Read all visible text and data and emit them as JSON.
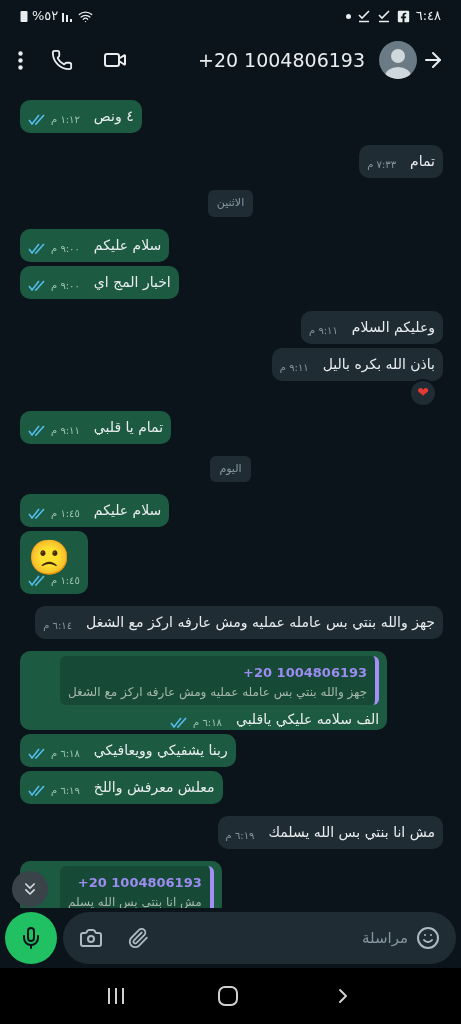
{
  "status_bar": {
    "time": "٦:٤٨",
    "battery": "%٥٢"
  },
  "header": {
    "title": "+20 1004806193"
  },
  "messages": [
    {
      "kind": "sent",
      "text": "٤ ونص",
      "time": "١:١٢ م",
      "read": true
    },
    {
      "kind": "received",
      "text": "تمام",
      "time": "٧:٣٣ م"
    },
    {
      "kind": "date",
      "text": "الاثنين"
    },
    {
      "kind": "sent",
      "text": "سلام عليكم",
      "time": "٩:٠٠ م",
      "read": true
    },
    {
      "kind": "sent",
      "text": "اخبار المج اي",
      "time": "٩:٠٠ م",
      "read": true
    },
    {
      "kind": "received",
      "text": "وعليكم السلام",
      "time": "٩:١١ م"
    },
    {
      "kind": "received",
      "text": "باذن الله بكره باليل",
      "time": "٩:١١ م",
      "reaction": "❤"
    },
    {
      "kind": "sent",
      "text": "تمام يا قلبي",
      "time": "٩:١١ م",
      "read": true
    },
    {
      "kind": "date",
      "text": "اليوم"
    },
    {
      "kind": "sent",
      "text": "سلام عليكم",
      "time": "١:٤٥ م",
      "read": true
    },
    {
      "kind": "emoji",
      "text": "🙁",
      "time": "١:٤٥ م",
      "read": true
    },
    {
      "kind": "received",
      "text": "جهز والله بنتي بس عامله عمليه ومش عارفه اركز مع الشغل",
      "time": "٦:١٤ م"
    },
    {
      "kind": "sent",
      "quote": {
        "name": "+20 1004806193",
        "text": "جهز والله بنتي بس عامله عمليه ومش عارفه اركز مع الشغل"
      },
      "text": "الف سلامه عليكي ياقلبي",
      "time": "٦:١٨ م",
      "read": true
    },
    {
      "kind": "sent",
      "text": "ربنا يشفيكي وويعافيكي",
      "time": "٦:١٨ م",
      "read": true
    },
    {
      "kind": "sent",
      "text": "معلش معرفش واللخ",
      "time": "٦:١٩ م",
      "read": true
    },
    {
      "kind": "received",
      "text": "مش انا بنتي بس الله يسلمك",
      "time": "٦:١٩ م"
    },
    {
      "kind": "sent",
      "quote": {
        "name": "+20 1004806193",
        "text": "مش انا بنتي بس الله يسلم"
      }
    }
  ],
  "composer": {
    "placeholder": "مراسلة"
  }
}
